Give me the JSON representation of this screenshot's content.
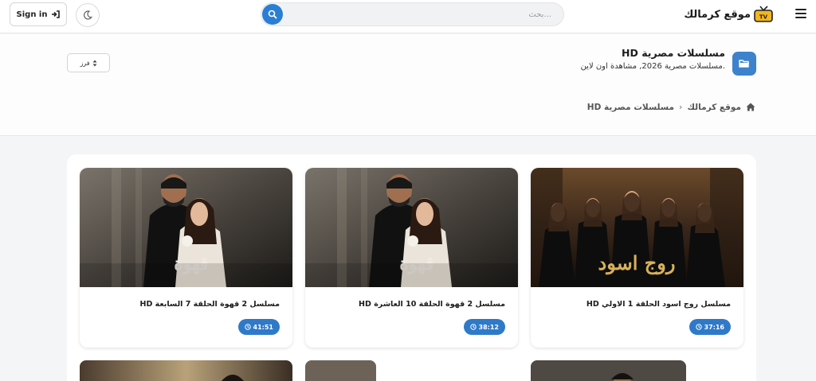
{
  "header": {
    "site_name": "موقع كرمالك",
    "search_placeholder": "بحث...",
    "signin_label": "Sign in"
  },
  "category": {
    "title": "HD مسلسلات مصرية",
    "description": "مسلسلات مصرية 2026, مشاهدة اون لاين.",
    "sort_label": "فرز"
  },
  "breadcrumb": {
    "home": "موقع كرمالك",
    "current": "HD مسلسلات مصرية"
  },
  "cards": [
    {
      "title": "مسلسل روج اسود الحلقة 1 الاولي HD",
      "duration": "37:16"
    },
    {
      "title": "مسلسل 2 قهوة الحلقة 10 العاشرة HD",
      "duration": "38:12"
    },
    {
      "title": "مسلسل 2 قهوة الحلقة 7 السابعة HD",
      "duration": "41:51"
    }
  ],
  "colors": {
    "accent": "#2f79c9",
    "folder_icon_bg": "#3d82cc"
  }
}
